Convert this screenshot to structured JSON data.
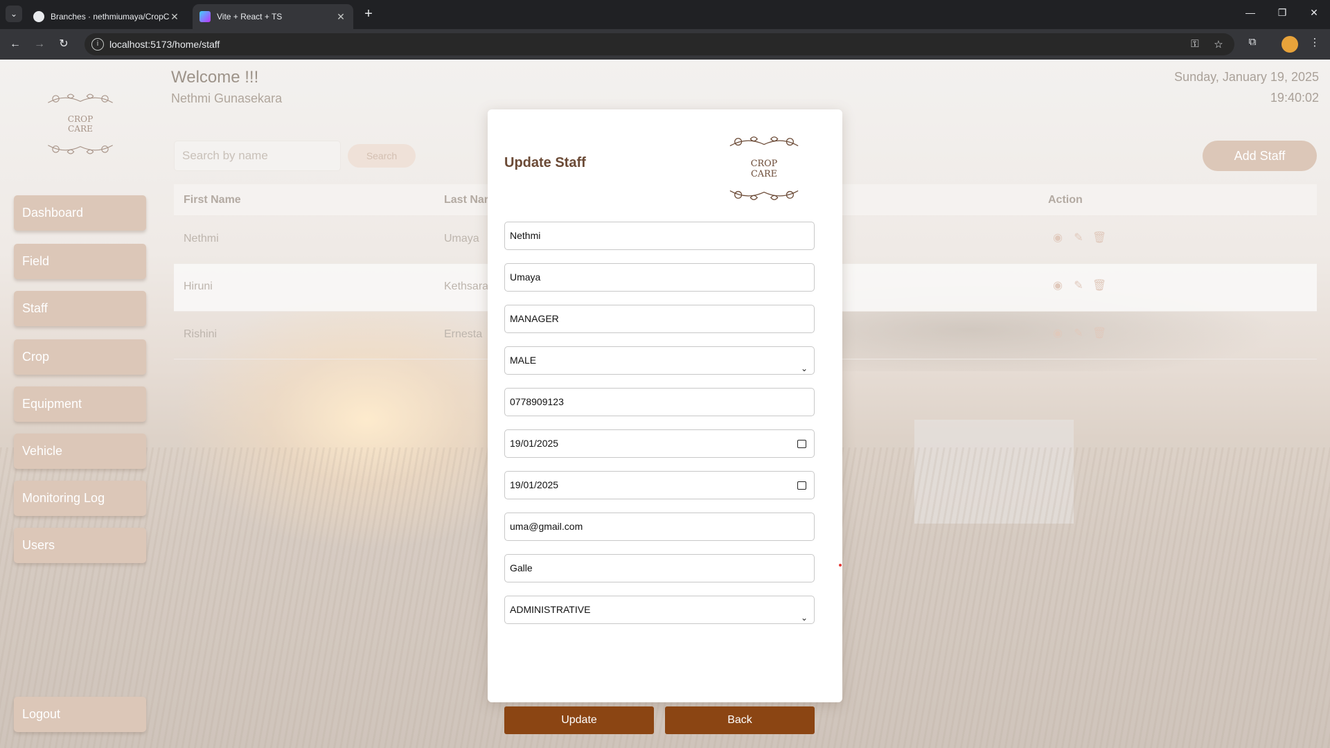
{
  "browser": {
    "tabs": [
      {
        "title": "Branches · nethmiumaya/CropC",
        "active": false,
        "icon": "github-icon"
      },
      {
        "title": "Vite + React + TS",
        "active": true,
        "icon": "vite-icon"
      }
    ],
    "url": "localhost:5173/home/staff"
  },
  "header": {
    "welcome": "Welcome !!!",
    "user_name": "Nethmi Gunasekara",
    "date": "Sunday, January 19, 2025",
    "time": "19:40:02"
  },
  "logo": {
    "line1": "CROP",
    "line2": "CARE"
  },
  "sidebar": {
    "items": [
      {
        "label": "Dashboard"
      },
      {
        "label": "Field"
      },
      {
        "label": "Staff"
      },
      {
        "label": "Crop"
      },
      {
        "label": "Equipment"
      },
      {
        "label": "Vehicle"
      },
      {
        "label": "Monitoring Log"
      },
      {
        "label": "Users"
      }
    ],
    "logout_label": "Logout"
  },
  "toolbar": {
    "search_placeholder": "Search by name",
    "search_label": "Search",
    "add_label": "Add Staff"
  },
  "table": {
    "columns": [
      "First Name",
      "Last Nar",
      "Action"
    ],
    "rows": [
      {
        "first_name": "Nethmi",
        "last_name": "Umaya"
      },
      {
        "first_name": "Hiruni",
        "last_name": "Kethsara"
      },
      {
        "first_name": "Rishini",
        "last_name": "Ernesta"
      }
    ],
    "action_icons": [
      "eye-icon",
      "pencil-icon",
      "trash-icon"
    ]
  },
  "modal": {
    "title": "Update Staff",
    "fields": {
      "first_name": "Nethmi",
      "last_name": "Umaya",
      "designation": "MANAGER",
      "gender": "MALE",
      "contact": "0778909123",
      "joined_date": "19/01/2025",
      "dob": "19/01/2025",
      "email": "uma@gmail.com",
      "address": "Galle",
      "role": "ADMINISTRATIVE"
    },
    "update_label": "Update",
    "back_label": "Back"
  },
  "colors": {
    "accent": "#8b4513",
    "sidebar_bg": "#dcc7b8",
    "title_brown": "#6b4a36"
  }
}
